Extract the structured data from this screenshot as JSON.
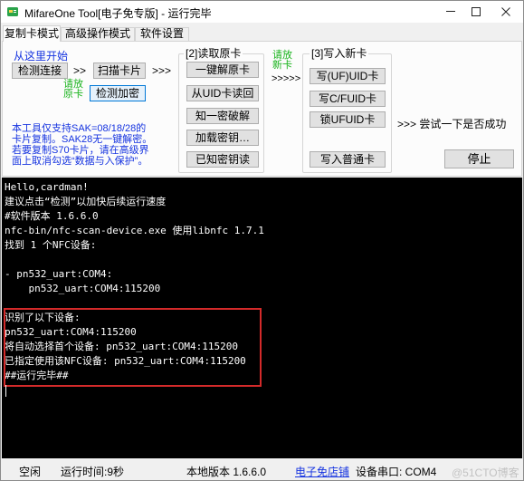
{
  "window": {
    "title": "MifareOne Tool[电子免专版] - 运行完毕",
    "app_icon": "app-icon",
    "minimize_icon": "minimize-icon",
    "maximize_icon": "maximize-icon",
    "close_icon": "close-icon"
  },
  "tabs": [
    {
      "label": "复制卡模式",
      "selected": true
    },
    {
      "label": "高级操作模式",
      "selected": false
    },
    {
      "label": "软件设置",
      "selected": false
    }
  ],
  "start_section": {
    "heading": "从这里开始",
    "detect_connection_button": "检测连接",
    "arrow_after_detect": ">>",
    "scan_card_button": "扫描卡片",
    "arrow_after_scan": ">>>",
    "place_original_card": [
      "请放",
      "原卡"
    ],
    "check_encryption_button": "检测加密",
    "notice_lines": [
      "本工具仅支持SAK=08/18/28的",
      "卡片复制。SAK28无一键解密。",
      "若要复制S70卡片，请在高级界",
      "面上取消勾选“数据与入保护”。"
    ]
  },
  "read_group": {
    "title": "[2]读取原卡",
    "buttons": [
      "一键解原卡",
      "从UID卡读回",
      "知一密破解",
      "加载密钥…",
      "已知密钥读"
    ]
  },
  "place_new_card": {
    "lines": [
      "请放",
      "新卡"
    ],
    "arrows": ">>>>>"
  },
  "write_group": {
    "title": "[3]写入新卡",
    "buttons": [
      "写(UF)UID卡",
      "写C/FUID卡",
      "锁UFUID卡",
      "写入普通卡"
    ]
  },
  "try_hint": ">>> 尝试一下是否成功",
  "stop_button": "停止",
  "console": {
    "lines": [
      "Hello,cardman!",
      "建议点击“检测”以加快后续运行速度",
      "#软件版本 1.6.6.0",
      "nfc-bin/nfc-scan-device.exe 使用libnfc 1.7.1",
      "找到 1 个NFC设备:",
      "",
      "- pn532_uart:COM4:",
      "    pn532_uart:COM4:115200",
      "",
      "识别了以下设备:",
      "pn532_uart:COM4:115200",
      "将自动选择首个设备: pn532_uart:COM4:115200",
      "已指定使用该NFC设备: pn532_uart:COM4:115200",
      "##运行完毕##"
    ]
  },
  "status_bar": {
    "state": "空闲",
    "run_time": "运行时间:9秒",
    "local_version": "本地版本 1.6.6.0",
    "shop_link": "电子免店铺",
    "device_port": "设备串口: COM4"
  },
  "watermark": "@51CTO博客",
  "colors": {
    "info_blue": "#1533e0",
    "hint_green": "#19b31c",
    "focus_border": "#0078d7",
    "console_bg": "#000000",
    "console_text": "#ffffff",
    "highlight_box": "#d42a2a"
  }
}
